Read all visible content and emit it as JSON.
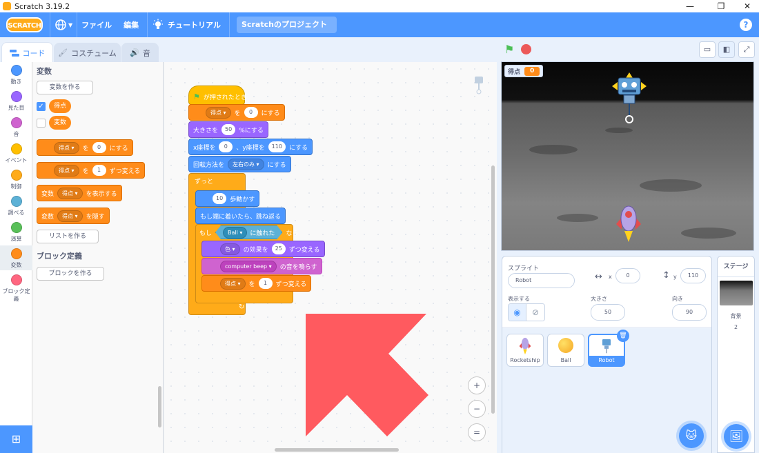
{
  "window": {
    "title": "Scratch 3.19.2",
    "controls": [
      "—",
      "❐",
      "✕"
    ]
  },
  "menubar": {
    "logo": "SCRATCH",
    "file": "ファイル",
    "edit": "編集",
    "tutorials": "チュートリアル",
    "project_title": "Scratchのプロジェクト",
    "help": "?"
  },
  "tabs": {
    "code": "コード",
    "costumes": "コスチューム",
    "sounds": "音"
  },
  "categories": [
    {
      "label": "動き",
      "color": "#4c97ff"
    },
    {
      "label": "見た目",
      "color": "#9966ff"
    },
    {
      "label": "音",
      "color": "#cf63cf"
    },
    {
      "label": "イベント",
      "color": "#ffbf00"
    },
    {
      "label": "制御",
      "color": "#ffab19"
    },
    {
      "label": "調べる",
      "color": "#5cb1d6"
    },
    {
      "label": "演算",
      "color": "#59c059"
    },
    {
      "label": "変数",
      "color": "#ff8c1a"
    },
    {
      "label": "ブロック定義",
      "color": "#ff6680"
    }
  ],
  "palette": {
    "heading_vars": "変数",
    "make_var": "変数を作る",
    "var_score": "得点",
    "var_other": "変数",
    "set_block": {
      "var": "得点",
      "to": "を",
      "value": "0",
      "suffix": "にする"
    },
    "change_block": {
      "var": "得点",
      "by": "を",
      "value": "1",
      "suffix": "ずつ変える"
    },
    "show_block": {
      "prefix": "変数",
      "var": "得点",
      "suffix": "を表示する"
    },
    "hide_block": {
      "prefix": "変数",
      "var": "得点",
      "suffix": "を隠す"
    },
    "make_list": "リストを作る",
    "heading_myblocks": "ブロック定義",
    "make_block": "ブロックを作る"
  },
  "script": {
    "hat": "が押されたとき",
    "set_score": {
      "var": "得点",
      "to": "を",
      "value": "0",
      "suffix": "にする"
    },
    "size": {
      "prefix": "大きさを",
      "value": "50",
      "suffix": "%にする"
    },
    "goto": {
      "x_label": "x座標を",
      "x": "0",
      "sep": "、y座標を",
      "y": "110",
      "suffix": "にする"
    },
    "rotation": {
      "prefix": "回転方法を",
      "value": "左右のみ",
      "suffix": "にする"
    },
    "forever": "ずっと",
    "move": {
      "value": "10",
      "suffix": "歩動かす"
    },
    "bounce": "もし端に着いたら、跳ね返る",
    "if": {
      "prefix": "もし",
      "target": "Ball",
      "touching": "に触れた",
      "then": "なら"
    },
    "effect": {
      "effect": "色",
      "mid": "の効果を",
      "value": "25",
      "suffix": "ずつ変える"
    },
    "sound": {
      "sound": "computer beep",
      "suffix": "の音を鳴らす"
    },
    "change_score": {
      "var": "得点",
      "by": "を",
      "value": "1",
      "suffix": "ずつ変える"
    },
    "loop_arrow": "↻"
  },
  "zoom": {
    "in": "+",
    "out": "−",
    "reset": "="
  },
  "stage": {
    "monitor_label": "得点",
    "monitor_value": "0"
  },
  "sprite_info": {
    "title": "スプライト",
    "name": "Robot",
    "x_label": "x",
    "x": "0",
    "y_label": "y",
    "y": "110",
    "show_label": "表示する",
    "size_label": "大きさ",
    "size": "50",
    "direction_label": "向き",
    "direction": "90"
  },
  "sprites": [
    {
      "name": "Rocketship"
    },
    {
      "name": "Ball"
    },
    {
      "name": "Robot"
    }
  ],
  "stage_pane": {
    "title": "ステージ",
    "backdrops_label": "背景",
    "backdrops_count": "2"
  },
  "colors": {
    "accent": "#4c97ff",
    "arrow": "#ff5a5f"
  }
}
